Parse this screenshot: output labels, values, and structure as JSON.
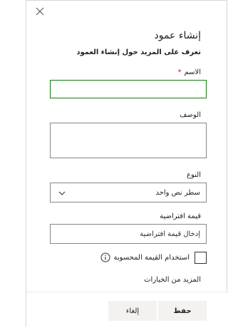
{
  "panel": {
    "close_icon": "close-icon",
    "title": "إنشاء عمود",
    "learn_more_link": "تعرف على المزيد حول إنشاء العمود"
  },
  "form": {
    "name": {
      "label": "الاسم",
      "required_mark": "*",
      "value": ""
    },
    "description": {
      "label": "الوصف",
      "value": ""
    },
    "type": {
      "label": "النوع",
      "selected": "سطر نص واحد",
      "icon": "chevron-down-icon"
    },
    "default_value": {
      "label": "قيمة افتراضية",
      "placeholder": "إدخال قيمة افتراضية"
    },
    "calculated": {
      "label": "استخدام القيمة المحسوبة",
      "checked": false,
      "info_icon": "info-icon"
    },
    "more_options": "المزيد من الخيارات"
  },
  "footer": {
    "save_label": "حفظ",
    "cancel_label": "إلغاء"
  }
}
